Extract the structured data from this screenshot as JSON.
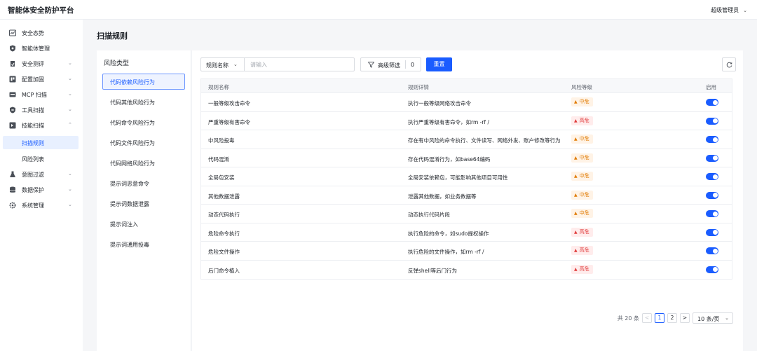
{
  "app": {
    "title": "智能体安全防护平台",
    "user": "超级管理员"
  },
  "sidebar": {
    "items": [
      {
        "label": "安全态势",
        "icon": "dashboard-icon"
      },
      {
        "label": "智能体管理",
        "icon": "shield-icon"
      },
      {
        "label": "安全测评",
        "icon": "test-icon",
        "expandable": true
      },
      {
        "label": "配置加固",
        "icon": "config-icon",
        "expandable": true
      },
      {
        "label": "MCP 扫描",
        "icon": "mcp-icon",
        "expandable": true
      },
      {
        "label": "工具扫描",
        "icon": "tool-shield-icon",
        "expandable": true
      },
      {
        "label": "技能扫描",
        "icon": "skill-icon",
        "expanded": true
      },
      {
        "label": "意图过滤",
        "icon": "flask-icon",
        "expandable": true
      },
      {
        "label": "数据保护",
        "icon": "database-icon",
        "expandable": true
      },
      {
        "label": "系统管理",
        "icon": "gear-icon",
        "expandable": true
      }
    ],
    "sub_items": [
      {
        "label": "扫描规则",
        "active": true
      },
      {
        "label": "风险列表"
      }
    ]
  },
  "page": {
    "title": "扫描规则"
  },
  "categories": {
    "header": "风险类型",
    "items": [
      "代码依赖风险行为",
      "代码其他风险行为",
      "代码命令风险行为",
      "代码文件风险行为",
      "代码网络风险行为",
      "提示词恶意命令",
      "提示词数据泄露",
      "提示词注入",
      "提示词通用投毒"
    ],
    "active_index": 0
  },
  "filter": {
    "select_label": "规则名称",
    "input_placeholder": "请输入",
    "advanced_label": "高级筛选",
    "advanced_count": "0",
    "reset_label": "重置"
  },
  "table": {
    "headers": [
      "规则名称",
      "规则详情",
      "风险等级",
      "启用"
    ],
    "rows": [
      {
        "name": "一般等级攻击命令",
        "detail": "执行一般等级网络攻击命令",
        "level": "中危",
        "severity": "mid",
        "enabled": true
      },
      {
        "name": "严重等级有害命令",
        "detail": "执行严重等级有害命令，如rm -rf /",
        "level": "高危",
        "severity": "high",
        "enabled": true
      },
      {
        "name": "中风险投毒",
        "detail": "存在有中风险的命令执行、文件读写、网络外发、账户修改等行为",
        "level": "中危",
        "severity": "mid",
        "enabled": true
      },
      {
        "name": "代码混淆",
        "detail": "存在代码混淆行为，如base64编码",
        "level": "中危",
        "severity": "mid",
        "enabled": true
      },
      {
        "name": "全局包安装",
        "detail": "全局安装依赖包，可能影响其他项目可用性",
        "level": "中危",
        "severity": "mid",
        "enabled": true
      },
      {
        "name": "其他数据泄露",
        "detail": "泄露其他数据，如业务数据等",
        "level": "中危",
        "severity": "mid",
        "enabled": true
      },
      {
        "name": "动态代码执行",
        "detail": "动态执行代码片段",
        "level": "中危",
        "severity": "mid",
        "enabled": true
      },
      {
        "name": "危险命令执行",
        "detail": "执行危险的命令，如sudo提权操作",
        "level": "高危",
        "severity": "high",
        "enabled": true
      },
      {
        "name": "危险文件操作",
        "detail": "执行危险的文件操作，如rm -rf /",
        "level": "高危",
        "severity": "high",
        "enabled": true
      },
      {
        "name": "后门命令植入",
        "detail": "反弹shell等后门行为",
        "level": "高危",
        "severity": "high",
        "enabled": true
      }
    ]
  },
  "pagination": {
    "total": "共 20 条",
    "prev": "<",
    "pages": [
      "1",
      "2"
    ],
    "next": ">",
    "current": "1",
    "page_size": "10 条/页"
  },
  "colors": {
    "primary": "#1a5cff",
    "mid_risk": "#e07a00",
    "high_risk": "#e03b3b"
  }
}
